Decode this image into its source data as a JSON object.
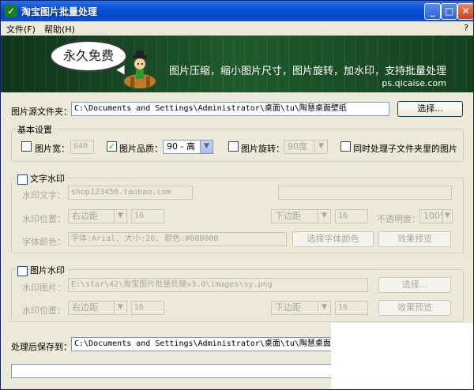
{
  "titlebar": {
    "title": "淘宝图片批量处理",
    "min_glyph": "_",
    "max_glyph": "□",
    "close_glyph": "✕",
    "app_icon_glyph": "✓"
  },
  "menubar": {
    "file": "文件(F)",
    "help": "帮助(H)",
    "help_q": "?"
  },
  "banner": {
    "bubble_text": "永久免费",
    "tagline": "图片压缩，缩小图片尺寸，图片旋转，加水印，支持批量处理",
    "url": "ps.qicaise.com"
  },
  "source": {
    "label": "图片源文件夹：",
    "value": "C:\\Documents and Settings\\Administrator\\桌面\\tu\\陶慧桌面壁纸",
    "choose_button": "选择..."
  },
  "basic": {
    "legend": "基本设置",
    "width_label": "图片宽：",
    "width_value": "640",
    "quality_label": "图片品质：",
    "quality_value": "90 - 高",
    "rotate_label": "图片旋转：",
    "rotate_value": "90度",
    "subfolder_label": "同时处理子文件夹里的图片"
  },
  "text_watermark": {
    "legend": "文字水印",
    "text_label": "水印文字：",
    "text_value": "shop123456.taobao.com",
    "position_label": "水印位置：",
    "h_align": "右边距",
    "h_offset": "16",
    "v_align": "下边距",
    "v_offset": "16",
    "opacity_label": "不透明度：",
    "opacity_value": "100%",
    "font_label": "字体颜色：",
    "font_value": "字体:Arial, 大小:26, 颜色:#000000",
    "choose_font_button": "选择字体颜色",
    "preview_button": "效果预览"
  },
  "image_watermark": {
    "legend": "图片水印",
    "image_label": "水印图片：",
    "image_value": "E:\\star\\42\\淘宝图片批量处理v3.0\\images\\sy.png",
    "choose_button": "选择...",
    "position_label": "水印位置：",
    "h_align": "右边距",
    "h_offset": "16",
    "v_align": "下边距",
    "v_offset": "16",
    "preview_button": "效果预览"
  },
  "output": {
    "label": "处理后保存到：",
    "value": "C:\\Documents and Settings\\Administrator\\桌面\\tu\\陶慧桌面壁纸_处"
  }
}
